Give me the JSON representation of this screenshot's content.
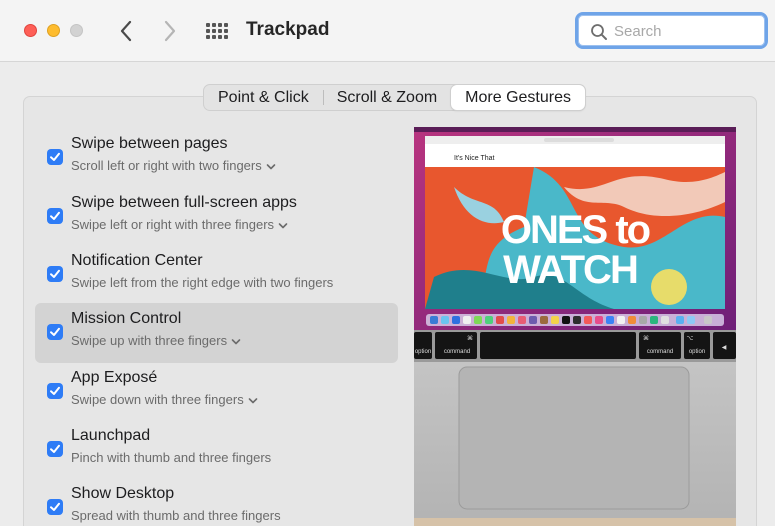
{
  "window": {
    "title": "Trackpad"
  },
  "search": {
    "placeholder": "Search"
  },
  "tabs": [
    {
      "label": "Point & Click",
      "active": false
    },
    {
      "label": "Scroll & Zoom",
      "active": false
    },
    {
      "label": "More Gestures",
      "active": true
    }
  ],
  "gestures": [
    {
      "title": "Swipe between pages",
      "subtitle": "Scroll left or right with two fingers",
      "checked": true,
      "has_menu": true
    },
    {
      "title": "Swipe between full-screen apps",
      "subtitle": "Swipe left or right with three fingers",
      "checked": true,
      "has_menu": true
    },
    {
      "title": "Notification Center",
      "subtitle": "Swipe left from the right edge with two fingers",
      "checked": true,
      "has_menu": false
    },
    {
      "title": "Mission Control",
      "subtitle": "Swipe up with three fingers",
      "checked": true,
      "has_menu": true,
      "selected": true
    },
    {
      "title": "App Exposé",
      "subtitle": "Swipe down with three fingers",
      "checked": true,
      "has_menu": true
    },
    {
      "title": "Launchpad",
      "subtitle": "Pinch with thumb and three fingers",
      "checked": true,
      "has_menu": false
    },
    {
      "title": "Show Desktop",
      "subtitle": "Spread with thumb and three fingers",
      "checked": true,
      "has_menu": false
    }
  ],
  "preview": {
    "site_name": "It's Nice That",
    "headline_line1": "ONES to",
    "headline_line2": "WATCH",
    "keys": {
      "option_left": "option",
      "command_left": "command",
      "command_symbol": "⌘",
      "command_right": "command",
      "option_right": "option",
      "alt_symbol": "⌥",
      "arrow_left": "◀"
    }
  },
  "colors": {
    "accent": "#2e7cf6",
    "search_focus": "#6fa4e8",
    "selected_row": "#d3d3d3",
    "preview_sky": "#9d2a7e",
    "preview_hero": "#e8572e"
  }
}
